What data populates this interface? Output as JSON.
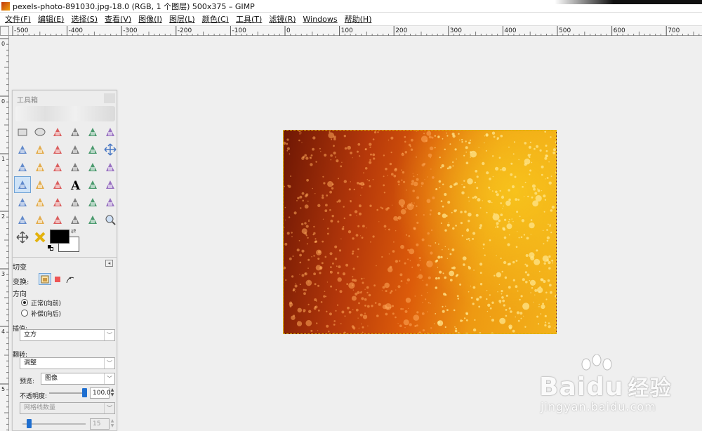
{
  "window": {
    "title": "pexels-photo-891030.jpg-18.0 (RGB, 1 个图层) 500x375 – GIMP"
  },
  "menu": [
    "文件(F)",
    "编辑(E)",
    "选择(S)",
    "查看(V)",
    "图像(I)",
    "图层(L)",
    "颜色(C)",
    "工具(T)",
    "滤镜(R)",
    "Windows",
    "帮助(H)"
  ],
  "hruler": {
    "labels": [
      "-500",
      "-400",
      "-300",
      "-200",
      "-100",
      "0",
      "100",
      "200",
      "300",
      "400",
      "500",
      "600",
      "700"
    ]
  },
  "vruler": {
    "labels": [
      "0",
      "0",
      "1",
      "2",
      "3",
      "4",
      "5"
    ]
  },
  "toolbox": {
    "title": "工具箱",
    "tools": [
      "rect-select",
      "ellipse-select",
      "free-select",
      "fuzzy-select",
      "color-select",
      "scissors-select",
      "foreground-select",
      "paths",
      "color-picker",
      "zoom",
      "measure",
      "move",
      "align",
      "crop",
      "rotate",
      "scale",
      "shear",
      "perspective",
      "flip",
      "cage-transform",
      "unified-transform",
      "text",
      "bucket-fill",
      "blend",
      "pencil",
      "paintbrush",
      "eraser",
      "airbrush",
      "ink",
      "clone",
      "heal",
      "perspective-clone",
      "blur",
      "smudge",
      "dodge-burn",
      "magnify"
    ],
    "extra_tools": [
      "move-arrows",
      "x-tool",
      "stamp"
    ],
    "active_tool": "flip",
    "fg_color": "#000000",
    "bg_color": "#ffffff"
  },
  "options": {
    "title": "切变",
    "transform_label": "变换:",
    "direction_label": "方向",
    "direction_normal": "正常(向前)",
    "direction_corrective": "补偿(向后)",
    "interpolation_label": "插值:",
    "interpolation_value": "立方",
    "clipping_label": "翻转:",
    "clipping_value": "调整",
    "preview_label": "预览:",
    "preview_value": "图像",
    "opacity_label": "不透明度:",
    "opacity_value": "100.0",
    "guides_value": "网格线数量",
    "grid_value": "15"
  },
  "colors": {
    "accent": "#1f6fd0",
    "selection": "#d8b400"
  },
  "watermark": {
    "brand": "Bai",
    "brand2": "du",
    "cn": "经验",
    "url": "jingyan.baidu.com"
  }
}
